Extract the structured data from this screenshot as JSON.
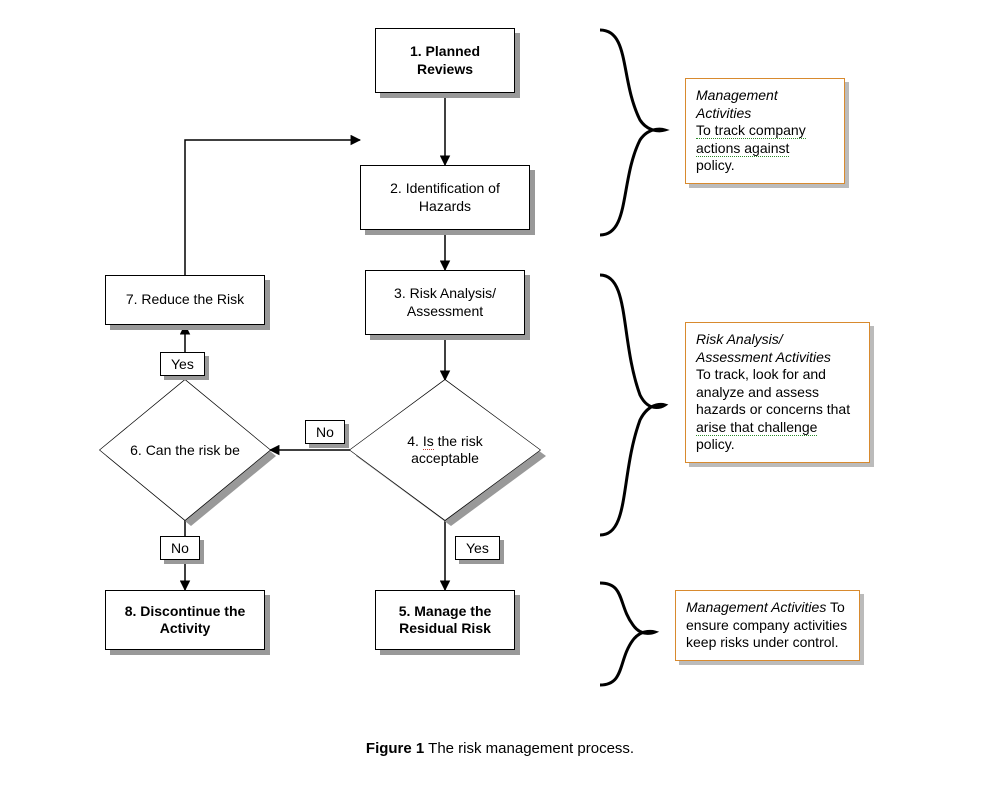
{
  "nodes": {
    "n1": "1. Planned Reviews",
    "n2": "2. Identification of Hazards",
    "n3": "3. Risk Analysis/ Assessment",
    "n4": "4. Is the risk acceptable",
    "n5": "5. Manage the Residual Risk",
    "n6": "6. Can the risk be",
    "n7": "7. Reduce the Risk",
    "n8": "8. Discontinue the Activity"
  },
  "labels": {
    "yes": "Yes",
    "no": "No"
  },
  "notes": {
    "a_title": "Management Activities",
    "a_body1": "To track company",
    "a_body2": "actions against",
    "a_body3": "policy.",
    "b_title": "Risk Analysis/ Assessment Activities",
    "b_body": "To track, look for and analyze and assess hazards or concerns that",
    "b_body2": "arise that challenge",
    "b_body3": "policy.",
    "c_title": "Management Activities",
    "c_body": "To ensure company activities keep risks under control."
  },
  "caption_bold": "Figure 1",
  "caption_rest": " The risk management process."
}
